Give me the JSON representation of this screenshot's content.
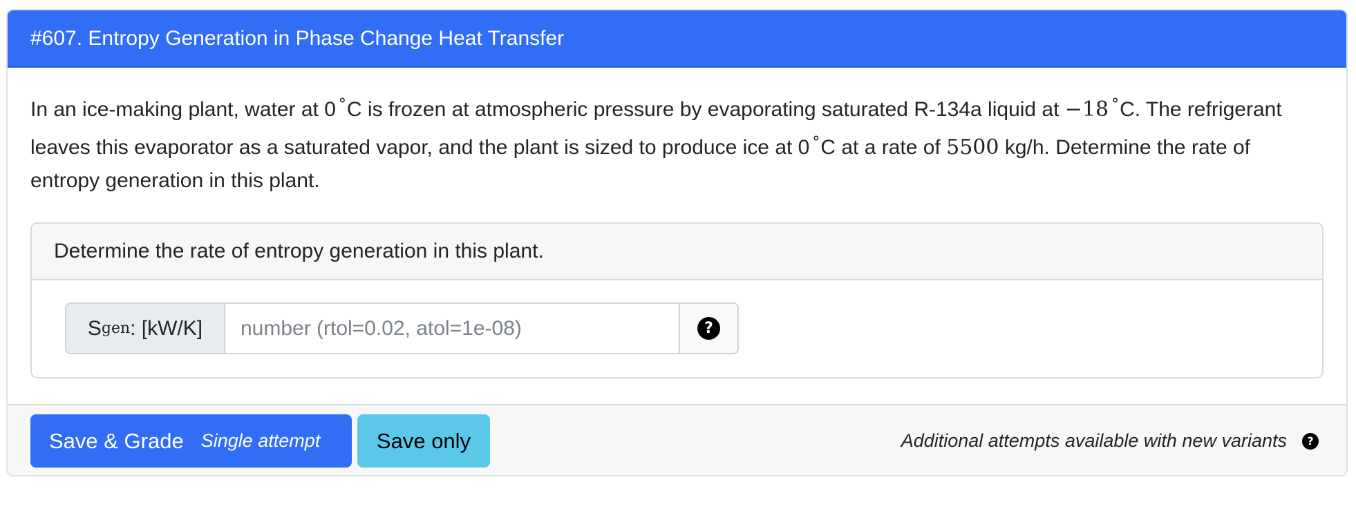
{
  "question": {
    "title": "#607. Entropy Generation in Phase Change Heat Transfer",
    "body": {
      "p1": "In an ice-making plant, water at 0",
      "deg": "°",
      "p2": "C is frozen at atmospheric pressure by evaporating saturated R-134a liquid at ",
      "temp_evap": "−18",
      "p3": "C. The refrigerant leaves this evaporator as a saturated vapor, and the plant is sized to produce ice at 0",
      "p4": "C at a rate of ",
      "rate": "5500",
      "p5": " kg/h. Determine the rate of entropy generation in this plant."
    }
  },
  "part": {
    "header": "Determine the rate of entropy generation in this plant.",
    "input": {
      "label_main": "S",
      "label_sub": "gen",
      "label_unit": ": [kW/K]",
      "placeholder": "number (rtol=0.02, atol=1e-08)",
      "value": "",
      "help_icon": "question-circle-icon",
      "help_glyph": "?"
    }
  },
  "footer": {
    "save_grade_label": "Save & Grade",
    "save_grade_sub": "Single attempt",
    "save_only_label": "Save only",
    "note": "Additional attempts available with new variants",
    "note_icon": "question-circle-icon",
    "note_glyph": "?"
  },
  "colors": {
    "header_bg": "#316df5",
    "primary": "#316df5",
    "info": "#5bc8ea",
    "footer_bg": "#f7f7f7"
  }
}
